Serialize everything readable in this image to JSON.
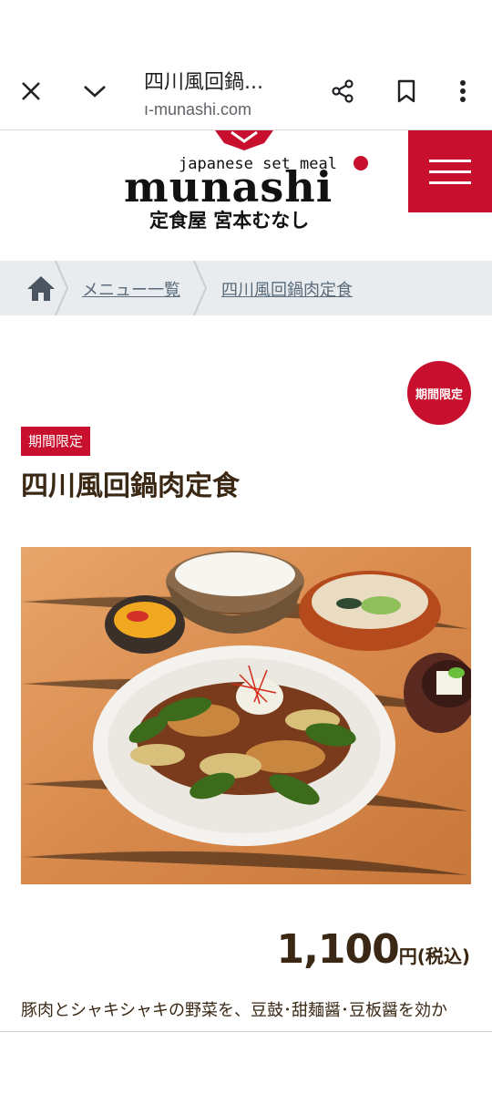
{
  "browser": {
    "title": "四川風回鍋...",
    "url": "ı-munashi.com",
    "icons": [
      "close-icon",
      "chevron-down-icon",
      "share-icon",
      "bookmark-icon",
      "more-vert-icon"
    ]
  },
  "header": {
    "logo_tagline": "japanese set meal",
    "logo_name": "munashi",
    "logo_japanese": "定食屋 宮本むなし",
    "menu_icon": "hamburger-icon"
  },
  "breadcrumb": {
    "home_icon": "home-icon",
    "items": [
      "メニュー一覧",
      "四川風回鍋肉定食"
    ]
  },
  "product": {
    "badge_circle": "期間限定",
    "badge_tag": "期間限定",
    "title": "四川風回鍋肉定食",
    "price": "1,100",
    "price_unit": "円(税込)",
    "description": "豚肉とシャキシャキの野菜を、豆鼓･甜麺醤･豆板醤を効か"
  },
  "colors": {
    "brand_red": "#c8102e",
    "breadcrumb_bg": "#e9ecef",
    "text_brown": "#3a2814"
  }
}
